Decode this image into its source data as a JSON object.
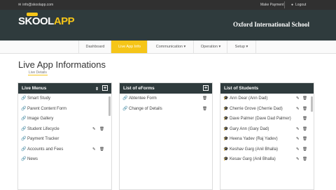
{
  "topbar": {
    "email": "info@skoolapp.com",
    "make_payment": "Make Payment",
    "logout": "Logout"
  },
  "brand": {
    "logo_part1": "SKOOL",
    "logo_part2": "APP",
    "school_name": "Oxford International School",
    "accent_color": "#f5c518",
    "header_color": "#2f3b3d"
  },
  "nav": {
    "items": [
      "Dashboard",
      "Live App Info",
      "Communication ▾",
      "Operation ▾",
      "Setup ▾"
    ],
    "active_index": 1
  },
  "page": {
    "title": "Live App Informations",
    "breadcrumb": "Live Details"
  },
  "panels": {
    "live_menus": {
      "title": "Live Menus",
      "items": [
        "Smart Study",
        "Parent Content Form",
        "Image Gallery",
        "Student Lifecycle",
        "Payment Tracker",
        "Accounts and Fees",
        "News"
      ],
      "with_actions": [
        3,
        5
      ]
    },
    "eforms": {
      "title": "List of eForms",
      "items": [
        "Abtentee Form",
        "Change of Details"
      ]
    },
    "students": {
      "title": "List of Students",
      "items": [
        "Ann Dear (Ann Dad)",
        "Cherrie Grove (Cherrie Dad)",
        "Dave Palmer (Dave Dad Palmer)",
        "Gary Ann (Gary Dad)",
        "Heena Yadev (Raj Yadev)",
        "Keshav Garg (Anil Bhalla)",
        "Kesav Garg (Anil Bhalla)"
      ]
    }
  }
}
